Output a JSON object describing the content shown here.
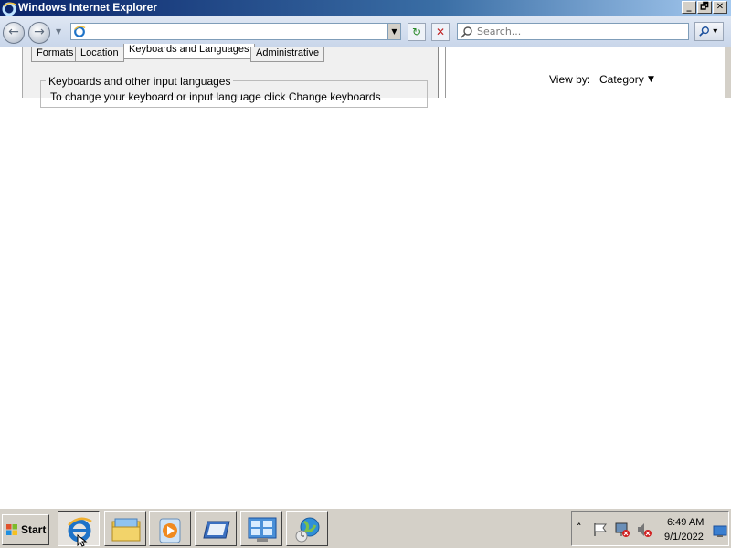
{
  "window": {
    "title": "Windows Internet Explorer",
    "minimize_label": "_",
    "maximize_label": "🗗",
    "close_label": "✕"
  },
  "navigation": {
    "back_label": "←",
    "forward_label": "→",
    "address_value": "",
    "refresh_label": "↻",
    "stop_label": "✕",
    "search_placeholder": "Search...",
    "search_button_label": "▾"
  },
  "dialog": {
    "tabs": [
      {
        "label": "Formats"
      },
      {
        "label": "Location"
      },
      {
        "label": "Keyboards and Languages"
      },
      {
        "label": "Administrative"
      }
    ],
    "group_title": "Keyboards and other input languages",
    "group_description": "To change your keyboard or input language click Change keyboards"
  },
  "control_panel": {
    "view_by_label": "View by:",
    "view_by_value": "Category"
  },
  "taskbar": {
    "start_label": "Start",
    "buttons": [
      {
        "icon": "internet-explorer-icon",
        "active": true
      },
      {
        "icon": "windows-explorer-icon",
        "active": false
      },
      {
        "icon": "media-player-icon",
        "active": false
      },
      {
        "icon": "server-manager-icon",
        "active": false
      },
      {
        "icon": "control-panel-icon",
        "active": false
      },
      {
        "icon": "network-globe-icon",
        "active": false
      }
    ],
    "tray": {
      "time": "6:49 AM",
      "date": "9/1/2022"
    }
  },
  "colors": {
    "titlebar_start": "#0a246a",
    "taskbar_bg": "#d4d0c8",
    "ie_blue": "#1e73c8"
  }
}
